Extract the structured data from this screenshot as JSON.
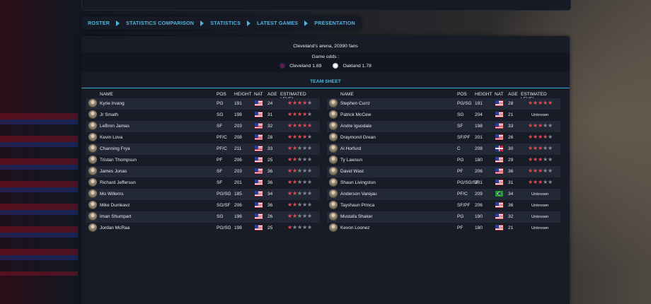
{
  "nav": {
    "items": [
      "ROSTER",
      "STATISTICS COMPARISON",
      "STATISTICS",
      "LATEST GAMES",
      "PRESENTATION"
    ]
  },
  "arena": "Cleveland's arena, 20390 fans",
  "odds": {
    "title": "Game odds :",
    "home": {
      "label": "Cleveland 1.89"
    },
    "away": {
      "label": "Oakland 1.78"
    }
  },
  "team_sheet": {
    "title": "TEAM SHEET",
    "headers": {
      "name": "NAME",
      "pos": "POS",
      "height": "HEIGHT",
      "nat": "NAT",
      "age": "AGE",
      "level": "ESTIMATED LEVEL"
    },
    "home_players": [
      {
        "name": "Kyrie Irvang",
        "pos": "PG",
        "height": "191",
        "nat": "us",
        "age": "24",
        "stars": 4
      },
      {
        "name": "Jr Smath",
        "pos": "SG",
        "height": "198",
        "nat": "us",
        "age": "31",
        "stars": 4
      },
      {
        "name": "LeBron Jamas",
        "pos": "SF",
        "height": "203",
        "nat": "us",
        "age": "32",
        "stars": 5
      },
      {
        "name": "Kevin Lova",
        "pos": "PF/C",
        "height": "208",
        "nat": "us",
        "age": "28",
        "stars": 4
      },
      {
        "name": "Channing Frya",
        "pos": "PF/C",
        "height": "211",
        "nat": "us",
        "age": "33",
        "stars": 2
      },
      {
        "name": "Tristan Thompsun",
        "pos": "PF",
        "height": "206",
        "nat": "us",
        "age": "25",
        "stars": 2
      },
      {
        "name": "James Jonas",
        "pos": "SF",
        "height": "203",
        "nat": "us",
        "age": "36",
        "stars": 2
      },
      {
        "name": "Richard Jeffersun",
        "pos": "SF",
        "height": "201",
        "nat": "us",
        "age": "36",
        "stars": 2
      },
      {
        "name": "Mo Willems",
        "pos": "PG/SG",
        "height": "185",
        "nat": "us",
        "age": "34",
        "stars": 2
      },
      {
        "name": "Mike Dunleavz",
        "pos": "SG/SF",
        "height": "206",
        "nat": "us",
        "age": "36",
        "stars": 2
      },
      {
        "name": "Iman Shumpart",
        "pos": "SG",
        "height": "196",
        "nat": "us",
        "age": "26",
        "stars": 2
      },
      {
        "name": "Jordan McRaa",
        "pos": "PG/SG",
        "height": "198",
        "nat": "us",
        "age": "25",
        "stars": 1
      }
    ],
    "away_players": [
      {
        "name": "Stephen Currz",
        "pos": "PG/SG",
        "height": "191",
        "nat": "us",
        "age": "28",
        "stars": 5
      },
      {
        "name": "Patrick McCew",
        "pos": "SG",
        "height": "204",
        "nat": "us",
        "age": "21",
        "unknown": "Unknown"
      },
      {
        "name": "Andre Iguodale",
        "pos": "SF",
        "height": "198",
        "nat": "us",
        "age": "33",
        "stars": 3
      },
      {
        "name": "Draymond Grean",
        "pos": "SF/PF",
        "height": "201",
        "nat": "us",
        "age": "26",
        "stars": 4
      },
      {
        "name": "Al Horfurd",
        "pos": "C",
        "height": "208",
        "nat": "do",
        "age": "30",
        "stars": 3
      },
      {
        "name": "Ty Lawsun",
        "pos": "PG",
        "height": "180",
        "nat": "us",
        "age": "29",
        "stars": 3
      },
      {
        "name": "David Wast",
        "pos": "PF",
        "height": "206",
        "nat": "us",
        "age": "36",
        "stars": 3
      },
      {
        "name": "Shaun Livingstun",
        "pos": "PG/SG/SF",
        "height": "201",
        "nat": "us",
        "age": "31",
        "stars": 3
      },
      {
        "name": "Anderson Varejau",
        "pos": "PF/C",
        "height": "209",
        "nat": "br",
        "age": "34",
        "unknown": "Unknown"
      },
      {
        "name": "Tayshaun Princa",
        "pos": "SF/PF",
        "height": "206",
        "nat": "us",
        "age": "36",
        "unknown": "Unknown"
      },
      {
        "name": "Mustafa Shaker",
        "pos": "PG",
        "height": "190",
        "nat": "us",
        "age": "32",
        "unknown": "Unknown"
      },
      {
        "name": "Kevon Loonez",
        "pos": "PF",
        "height": "180",
        "nat": "us",
        "age": "21",
        "unknown": "Unknown"
      }
    ]
  },
  "colors": {
    "accent": "#52b5dc",
    "star_on": "#e24a58",
    "star_off": "#878a92"
  }
}
